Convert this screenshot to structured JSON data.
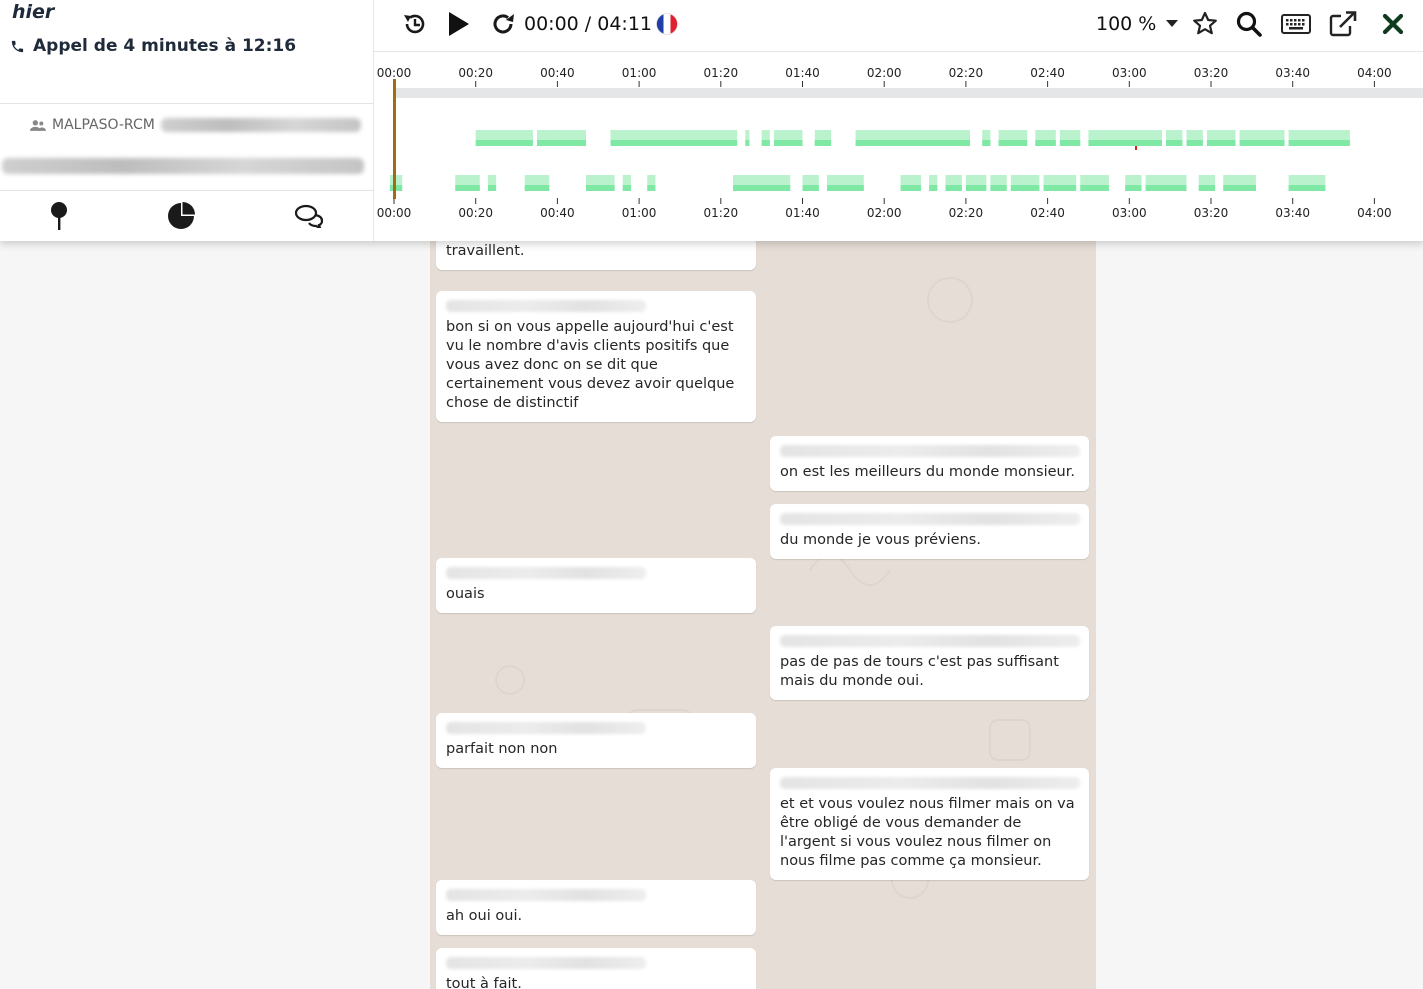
{
  "header": {
    "day_label": "hier",
    "call_title": "Appel de 4 minutes à 12:16",
    "group_name": "MALPASO-RCM",
    "icons": [
      "phone-icon",
      "users-icon",
      "map-pin-icon",
      "pie-chart-icon",
      "chat-icon"
    ]
  },
  "player": {
    "time": "00:00 / 04:11",
    "zoom": "100 %",
    "language_flag": "France",
    "controls": [
      "restart-icon",
      "play-icon",
      "redo-icon",
      "star-icon",
      "search-icon",
      "keyboard-icon",
      "external-link-icon",
      "close-icon"
    ]
  },
  "timeline": {
    "ticks_top": [
      "00:00",
      "00:20",
      "00:40",
      "01:00",
      "01:20",
      "01:40",
      "02:00",
      "02:20",
      "02:40",
      "03:00",
      "03:20",
      "03:40",
      "04:00"
    ],
    "ticks_bottom": [
      "00:00",
      "00:20",
      "00:40",
      "01:00",
      "01:20",
      "01:40",
      "02:00",
      "02:20",
      "02:40",
      "03:00",
      "03:20",
      "03:40",
      "04:00"
    ],
    "colors": {
      "speech": "#7fe8a4",
      "playhead": "#a36a10",
      "marker": "#e02020"
    }
  },
  "messages": [
    {
      "side": "left",
      "text": "raconter l'histoire des coiffeurs qui y travaillent."
    },
    {
      "side": "left",
      "text": "bon si on vous appelle aujourd'hui c'est vu le nombre d'avis clients positifs que vous avez donc on se dit que certainement vous devez avoir quelque chose de distinctif"
    },
    {
      "side": "right",
      "text": "on est les meilleurs du monde monsieur."
    },
    {
      "side": "right",
      "text": "du monde je vous préviens."
    },
    {
      "side": "left",
      "text": "ouais"
    },
    {
      "side": "right",
      "text": "pas de pas de tours c'est pas suffisant mais du monde oui."
    },
    {
      "side": "left",
      "text": "parfait non non"
    },
    {
      "side": "right",
      "text": "et et vous voulez nous filmer mais on va être obligé de vous demander de l'argent si vous voulez nous filmer on nous filme pas comme ça monsieur."
    },
    {
      "side": "left",
      "text": "ah oui oui."
    },
    {
      "side": "left",
      "text": "tout à fait."
    }
  ]
}
